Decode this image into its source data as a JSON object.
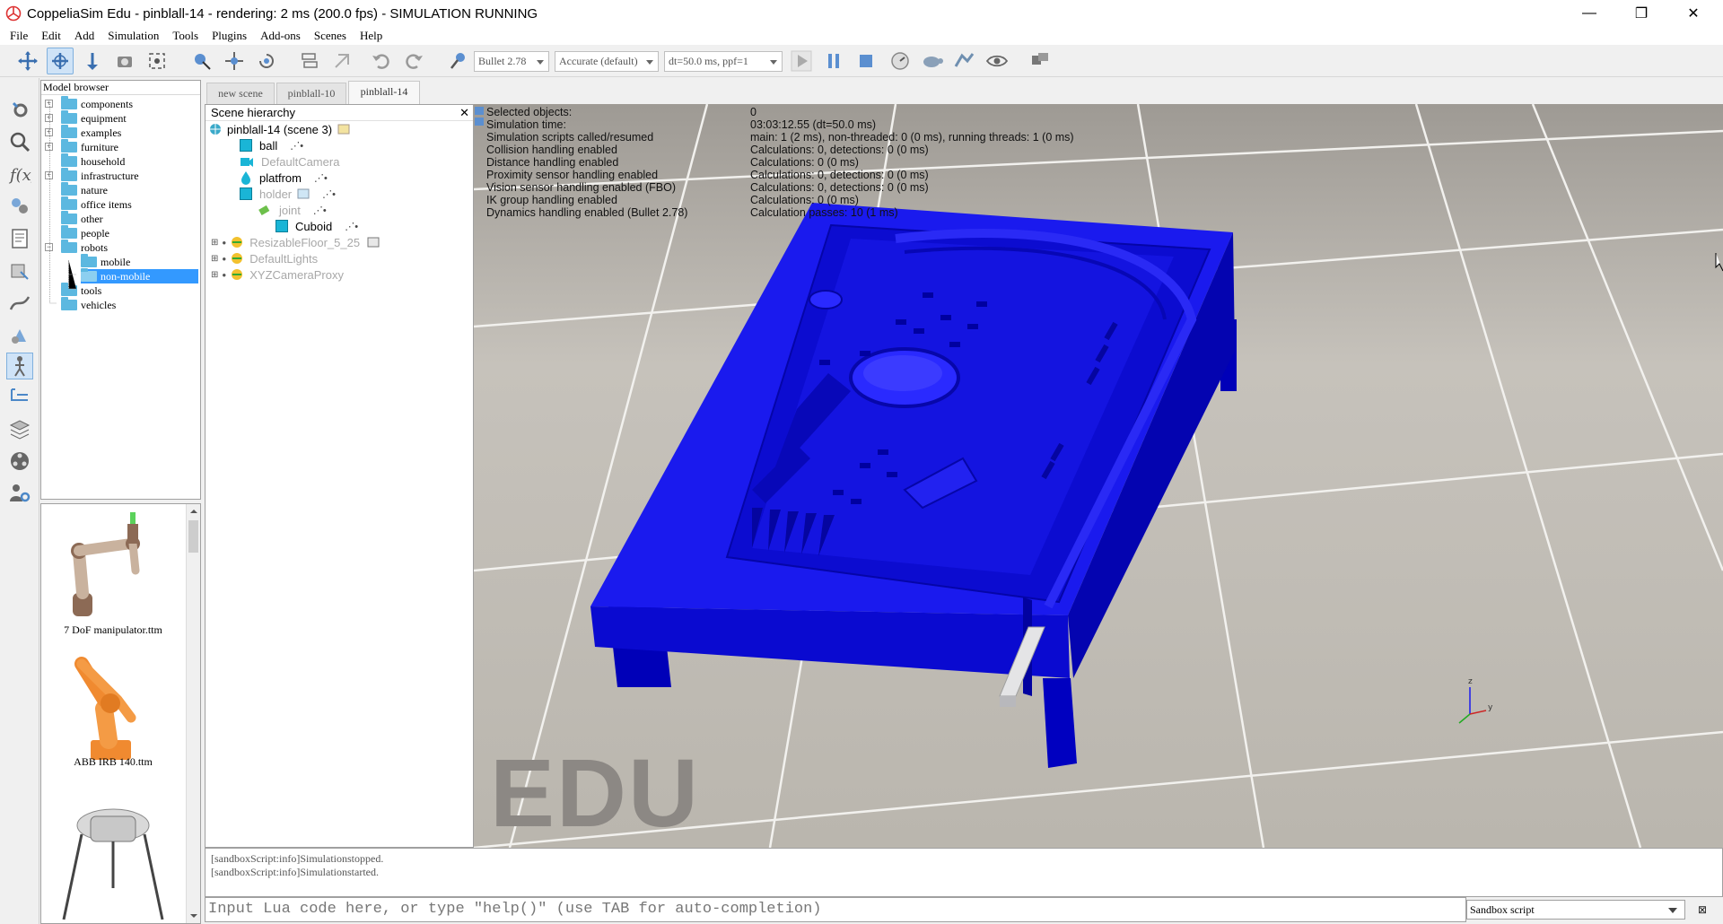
{
  "window": {
    "title": "CoppeliaSim Edu - pinblall-14 - rendering: 2 ms (200.0 fps) - SIMULATION RUNNING",
    "minimize": "—",
    "restore": "❐",
    "close": "✕"
  },
  "menu": [
    "File",
    "Edit",
    "Add",
    "Simulation",
    "Tools",
    "Plugins",
    "Add-ons",
    "Scenes",
    "Help"
  ],
  "toolbar": {
    "engine": "Bullet 2.78",
    "accuracy": "Accurate (default)",
    "timestep": "dt=50.0 ms, ppf=1"
  },
  "model_browser": {
    "header": "Model browser",
    "folders": [
      "components",
      "equipment",
      "examples",
      "furniture",
      "household",
      "infrastructure",
      "nature",
      "office items",
      "other",
      "people",
      "robots",
      "mobile",
      "non-mobile",
      "tools",
      "vehicles"
    ],
    "selected": "non-mobile",
    "thumbnails": [
      "7 DoF manipulator.ttm",
      "ABB IRB 140.ttm"
    ]
  },
  "tabs": [
    "new scene",
    "pinblall-10",
    "pinblall-14"
  ],
  "scene_hierarchy": {
    "header": "Scene hierarchy",
    "root": "pinblall-14 (scene 3)",
    "items": [
      "ball",
      "DefaultCamera",
      "platfrom",
      "holder",
      "joint",
      "Cuboid",
      "ResizableFloor_5_25",
      "DefaultLights",
      "XYZCameraProxy"
    ]
  },
  "info": {
    "labels": [
      "Selected objects:",
      "Simulation time:",
      "Simulation scripts called/resumed",
      "Collision handling enabled",
      "Distance handling enabled",
      "Proximity sensor handling enabled",
      "Vision sensor handling enabled (FBO)",
      "IK group handling enabled",
      "Dynamics handling enabled (Bullet 2.78)"
    ],
    "values": [
      "0",
      "03:03:12.55 (dt=50.0 ms)",
      "main: 1 (2 ms), non-threaded: 0 (0 ms), running threads: 1 (0 ms)",
      "Calculations: 0, detections: 0 (0 ms)",
      "Calculations: 0 (0 ms)",
      "Calculations: 0, detections: 0 (0 ms)",
      "Calculations: 0, detections: 0 (0 ms)",
      "Calculations: 0 (0 ms)",
      "Calculation passes: 10 (1 ms)"
    ]
  },
  "watermark": "EDU",
  "console": {
    "lines": [
      "[sandboxScript:info]Simulationstopped.",
      "[sandboxScript:info]Simulationstarted."
    ],
    "input_placeholder": "Input Lua code here, or type \"help()\" (use TAB for auto-completion)",
    "script_target": "Sandbox script"
  },
  "colors": {
    "table_blue": "#1a1aee",
    "selection": "#3399ff",
    "folder": "#5cb8e0"
  }
}
